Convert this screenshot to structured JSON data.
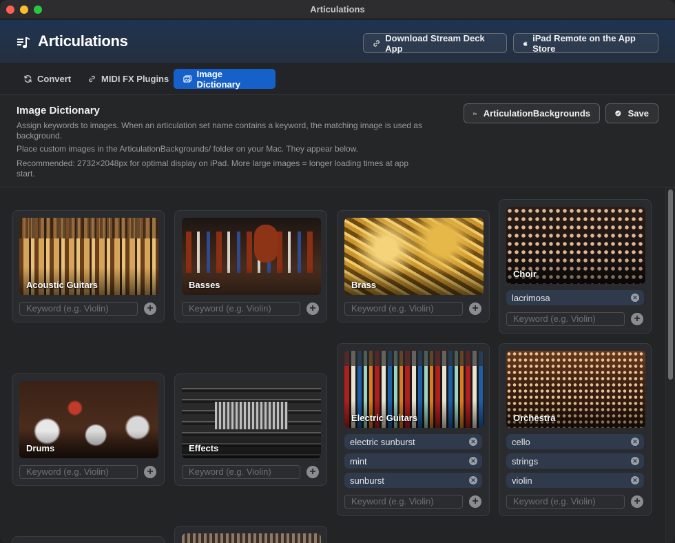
{
  "window": {
    "title": "Articulations"
  },
  "header": {
    "title": "Articulations",
    "buttons": {
      "stream_deck": "Download Stream Deck App",
      "ipad": "iPad Remote on the App Store"
    }
  },
  "tabs": [
    {
      "label": "Convert",
      "icon": "refresh-icon",
      "active": false
    },
    {
      "label": "MIDI FX Plugins",
      "icon": "link-icon",
      "active": false
    },
    {
      "label": "Image Dictionary",
      "icon": "photos-icon",
      "active": true
    }
  ],
  "section": {
    "title": "Image Dictionary",
    "desc1": "Assign keywords to images. When an articulation set name contains a keyword, the matching image is used as background.",
    "desc2": "Place custom images in the ArticulationBackgrounds/ folder on your Mac. They appear below.",
    "desc3": "Recommended: 2732×2048px for optimal display on iPad. More large images = longer loading times at app start.",
    "folder_button": "ArticulationBackgrounds",
    "save_button": "Save"
  },
  "keyword_placeholder": "Keyword (e.g. Violin)",
  "cards": [
    {
      "name": "Acoustic Guitars",
      "keywords": []
    },
    {
      "name": "Basses",
      "keywords": []
    },
    {
      "name": "Brass",
      "keywords": []
    },
    {
      "name": "Choir",
      "keywords": [
        "lacrimosa"
      ]
    },
    {
      "name": "Drums",
      "keywords": []
    },
    {
      "name": "Effects",
      "keywords": []
    },
    {
      "name": "Electric Guitars",
      "keywords": [
        "electric sunburst",
        "mint",
        "sunburst"
      ]
    },
    {
      "name": "Orchestra",
      "keywords": [
        "cello",
        "strings",
        "violin"
      ]
    }
  ],
  "colors": {
    "accent": "#1660c9",
    "keyword_chip": "#2f3b4d"
  }
}
